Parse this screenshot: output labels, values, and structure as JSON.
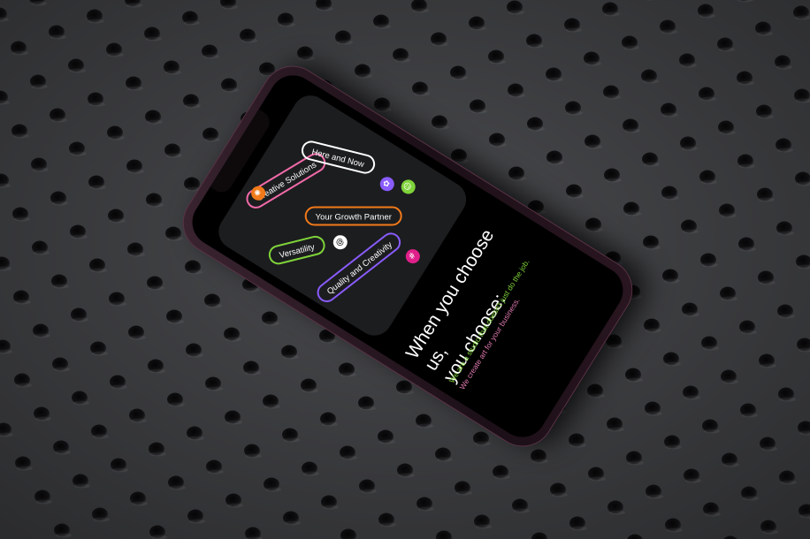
{
  "colors": {
    "surface": "#353638",
    "phone_body": "#2a1620",
    "screen": "#000000",
    "card": "#1c1d1f",
    "orange": "#f07a1a",
    "pink": "#f06aa8",
    "white": "#ffffff",
    "green": "#7fd33a",
    "purple": "#8a5cff",
    "magenta": "#e0208a",
    "sub_green": "#7fd33a",
    "sub_pink": "#e07ab0"
  },
  "phone": {
    "pills": [
      {
        "label": "Creative Solutions",
        "color": "#f06aa8"
      },
      {
        "label": "Here and Now",
        "color": "#ffffff"
      },
      {
        "label": "Versatility",
        "color": "#7fd33a"
      },
      {
        "label": "Your Growth Partner",
        "color": "#f07a1a"
      },
      {
        "label": "Quality and Creativity",
        "color": "#8a5cff"
      }
    ],
    "dots": [
      {
        "icon": "flame-icon",
        "glyph": "✺",
        "color": "#f07a1a"
      },
      {
        "icon": "smile-icon",
        "glyph": "☺",
        "color": "#7fd33a"
      },
      {
        "icon": "flower-icon",
        "glyph": "✿",
        "color": "#8a5cff"
      },
      {
        "icon": "at-icon",
        "glyph": "@",
        "color": "#ffffff"
      },
      {
        "icon": "hash-icon",
        "glyph": "#",
        "color": "#e0208a"
      }
    ],
    "headline_line1": "When you choose us,",
    "headline_line2": "you choose:",
    "sub_line1": "We are a studio that doesn't just do the job.",
    "sub_line2": "We create art for your business."
  }
}
